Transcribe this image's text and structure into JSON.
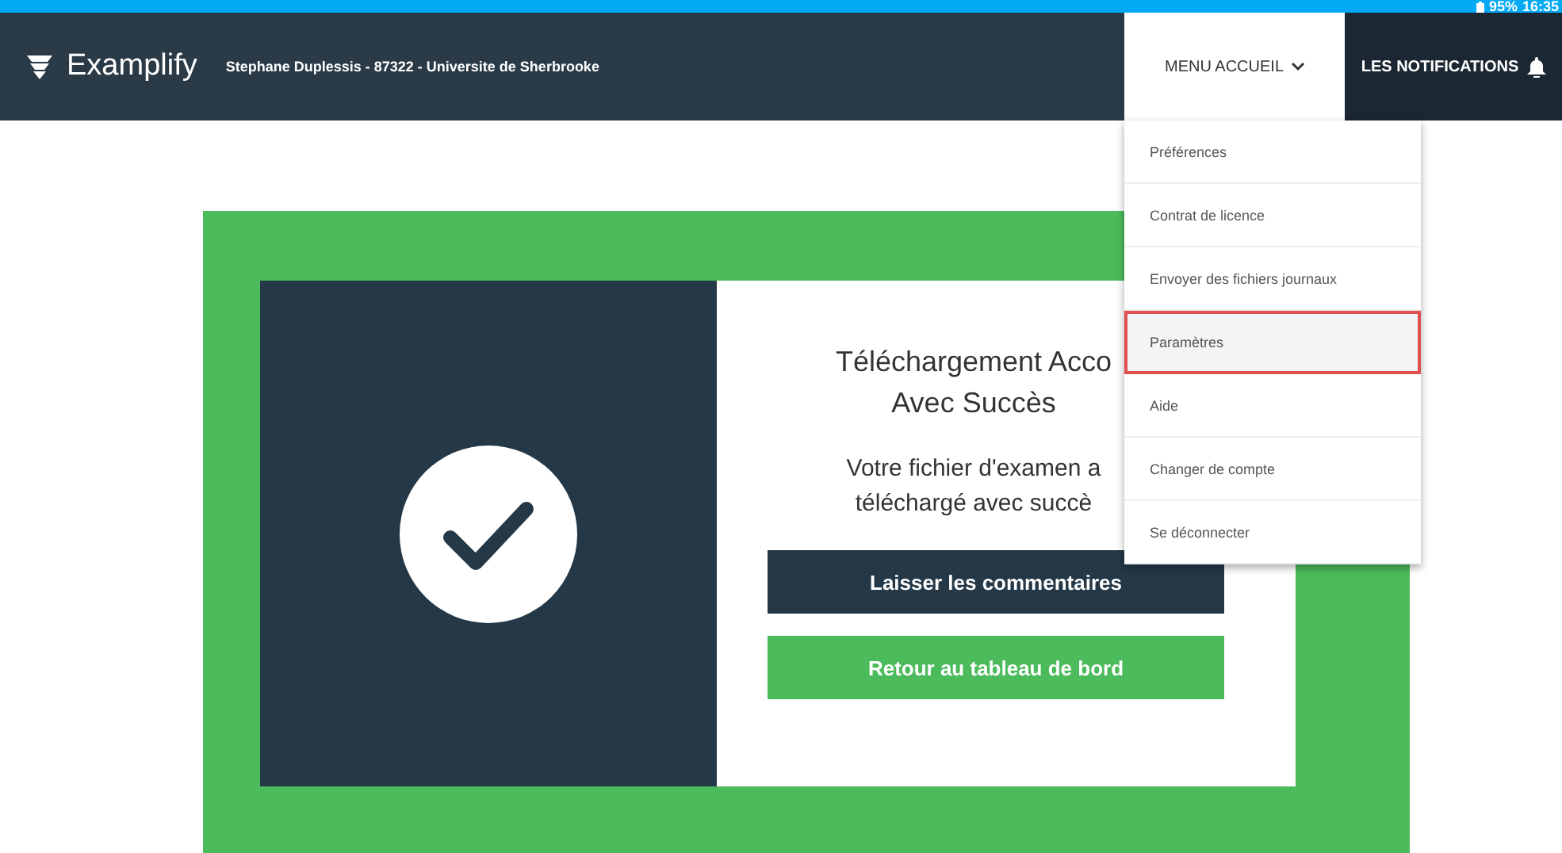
{
  "status_bar": {
    "battery": "95%",
    "time": "16:35"
  },
  "header": {
    "logo": "Examplify",
    "user": "Stephane Duplessis - 87322 - Universite de Sherbrooke",
    "menu": {
      "label": "MENU ACCUEIL",
      "expanded": true
    },
    "notifications": "LES NOTIFICATIONS"
  },
  "card": {
    "title_lines": [
      "Téléchargement Acco",
      "Avec Succès"
    ],
    "message_lines": [
      "Votre fichier d'examen a",
      "téléchargé avec succè"
    ],
    "buttons": [
      {
        "label": "Laisser les commentaires",
        "kind": "dark"
      },
      {
        "label": "Retour au tableau de bord",
        "kind": "green"
      }
    ]
  },
  "menu_items": [
    {
      "label": "Préférences",
      "selected": false
    },
    {
      "label": "Contrat de licence",
      "selected": false
    },
    {
      "label": "Envoyer des fichiers journaux",
      "selected": false
    },
    {
      "label": "Paramètres",
      "selected": true
    },
    {
      "label": "Aide",
      "selected": false
    },
    {
      "label": "Changer de compte",
      "selected": false
    },
    {
      "label": "Se déconnecter",
      "selected": false
    }
  ]
}
